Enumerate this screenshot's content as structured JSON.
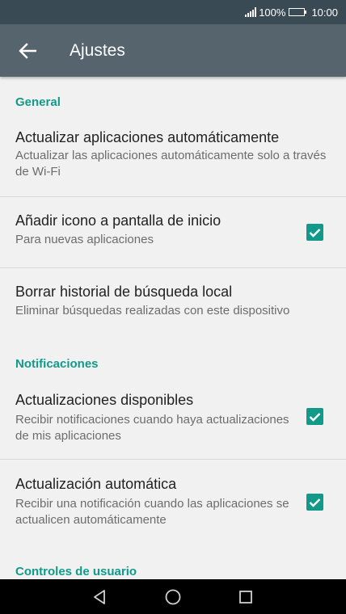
{
  "status_bar": {
    "battery_percent": "100%",
    "time": "10:00",
    "icons": [
      "signal-icon",
      "battery-icon"
    ]
  },
  "app_bar": {
    "back_icon": "arrow-left-icon",
    "title": "Ajustes"
  },
  "sections": [
    {
      "header": "General",
      "items": [
        {
          "title": "Actualizar aplicaciones automáticamente",
          "subtitle": "Actualizar las aplicaciones automáticamente solo a través de Wi-Fi",
          "checkbox": null
        },
        {
          "title": "Añadir icono a pantalla de inicio",
          "subtitle": "Para nuevas aplicaciones",
          "checkbox": true
        },
        {
          "title": "Borrar historial de búsqueda local",
          "subtitle": "Eliminar búsquedas realizadas con este dispositivo",
          "checkbox": null
        }
      ]
    },
    {
      "header": "Notificaciones",
      "items": [
        {
          "title": "Actualizaciones disponibles",
          "subtitle": "Recibir notificaciones cuando haya actualizaciones de mis aplicaciones",
          "checkbox": true
        },
        {
          "title": "Actualización automática",
          "subtitle": "Recibir una notificación cuando las aplicaciones se actualicen automáticamente",
          "checkbox": true
        }
      ]
    },
    {
      "header": "Controles de usuario",
      "items": []
    }
  ],
  "nav_bar": {
    "icons": [
      "back-triangle-icon",
      "home-circle-icon",
      "recents-square-icon"
    ]
  },
  "colors": {
    "accent": "#119a8a",
    "app_bar": "#56646d",
    "status_bar": "#3a4a54",
    "background": "#f1f1f1"
  }
}
